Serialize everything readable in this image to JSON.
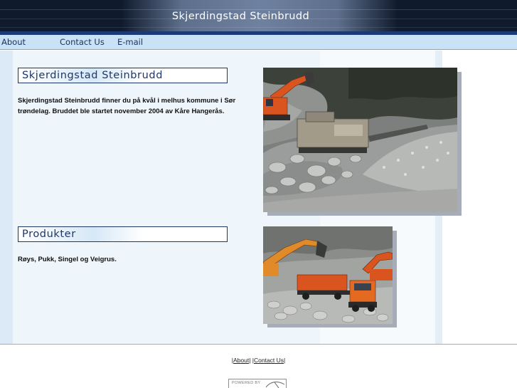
{
  "header": {
    "title": "Skjerdingstad Steinbrudd"
  },
  "nav": {
    "items": [
      {
        "label": "About"
      },
      {
        "label": "Contact Us"
      },
      {
        "label": "E-mail"
      }
    ]
  },
  "sections": [
    {
      "title": "Skjerdingstad Steinbrudd",
      "text": "Skjerdingstad Steinbrudd finner du på kvål i melhus kommune i Sør trøndelag. Bruddet ble startet november 2004 av Kåre Hangerås."
    },
    {
      "title": "Produkter",
      "text": "Røys, Pukk, Singel og Veigrus."
    }
  ],
  "footer": {
    "open_bracket": "|",
    "link_about": "About",
    "separator": "| |",
    "link_contact": "Contact Us",
    "close_bracket": "|",
    "powered_text": "POWERED BY"
  },
  "colors": {
    "header_bg": "#0f1a2c",
    "nav_bg": "#c9e2f5",
    "accent": "#1f3668",
    "excavator_orange": "#d9541e"
  }
}
